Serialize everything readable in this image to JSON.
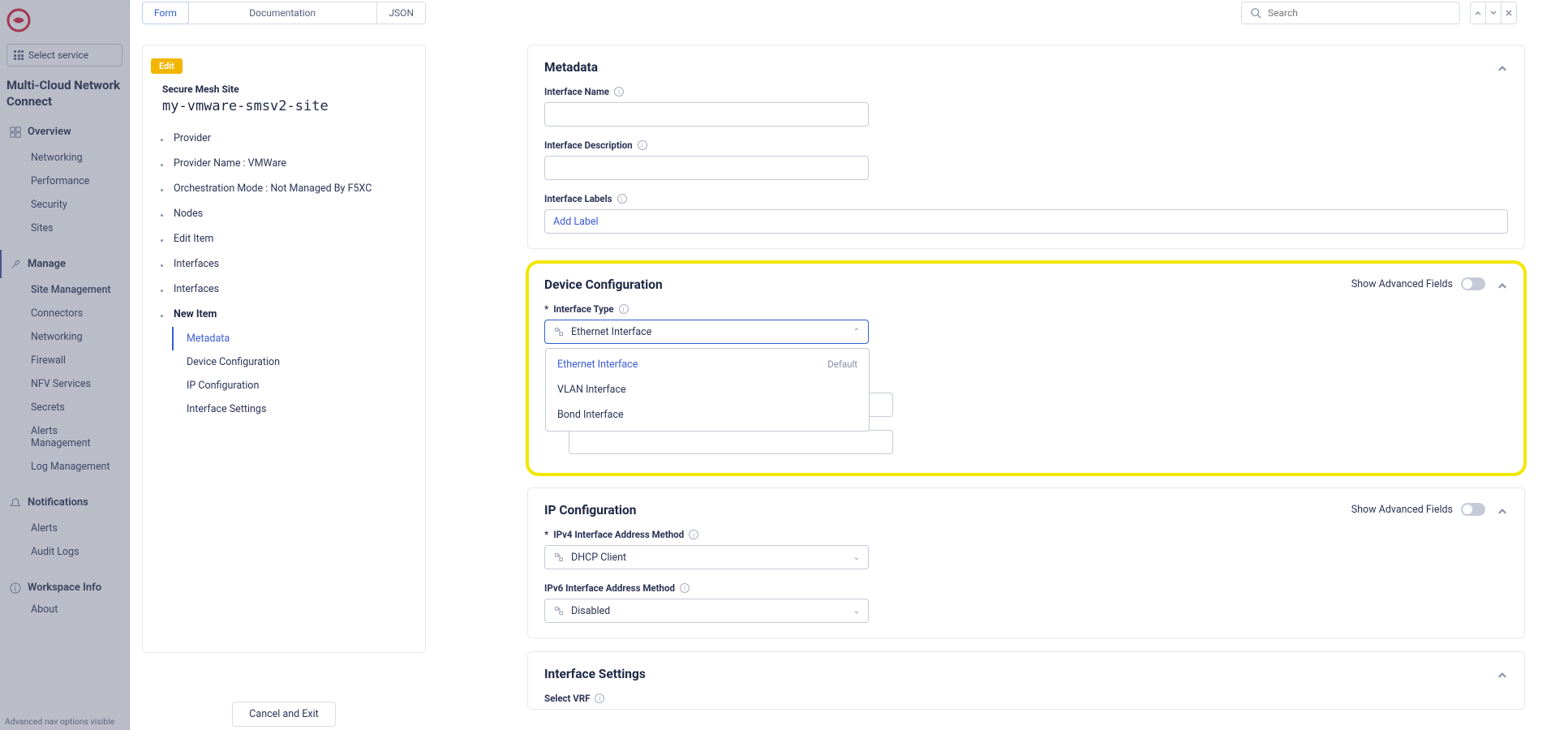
{
  "bg": {
    "select_service": "Select service",
    "app_title": "Multi-Cloud Network Connect",
    "sections": {
      "overview": "Overview",
      "manage": "Manage",
      "notifications": "Notifications",
      "workspace": "Workspace Info"
    },
    "overview_items": [
      "Networking",
      "Performance",
      "Security",
      "Sites"
    ],
    "manage_items": [
      "Site Management",
      "Connectors",
      "Networking",
      "Firewall",
      "NFV Services",
      "Secrets",
      "Alerts Management",
      "Log Management"
    ],
    "notif_items": [
      "Alerts",
      "Audit Logs"
    ],
    "about": "About",
    "footer": "Advanced nav options visible"
  },
  "tabs": {
    "form": "Form",
    "doc": "Documentation",
    "json": "JSON"
  },
  "search": {
    "placeholder": "Search"
  },
  "panel": {
    "edit": "Edit",
    "subtitle": "Secure Mesh Site",
    "title": "my-vmware-smsv2-site",
    "items": [
      "Provider",
      "Provider Name : VMWare",
      "Orchestration Mode : Not Managed By F5XC",
      "Nodes",
      "Edit Item",
      "Interfaces",
      "Interfaces"
    ],
    "new_item": "New Item",
    "subs": [
      "Metadata",
      "Device Configuration",
      "IP Configuration",
      "Interface Settings"
    ]
  },
  "form": {
    "metadata": {
      "title": "Metadata",
      "name": "Interface Name",
      "desc": "Interface Description",
      "labels": "Interface Labels",
      "add_label": "Add Label"
    },
    "device": {
      "title": "Device Configuration",
      "adv": "Show Advanced Fields",
      "type": "Interface Type",
      "selected": "Ethernet Interface",
      "options": [
        {
          "label": "Ethernet Interface",
          "default": "Default"
        },
        {
          "label": "VLAN Interface",
          "default": ""
        },
        {
          "label": "Bond Interface",
          "default": ""
        }
      ]
    },
    "ip": {
      "title": "IP Configuration",
      "adv": "Show Advanced Fields",
      "v4": "IPv4 Interface Address Method",
      "v4_sel": "DHCP Client",
      "v6": "IPv6 Interface Address Method",
      "v6_sel": "Disabled"
    },
    "iface": {
      "title": "Interface Settings",
      "vrf": "Select VRF"
    }
  },
  "cancel": "Cancel and Exit"
}
